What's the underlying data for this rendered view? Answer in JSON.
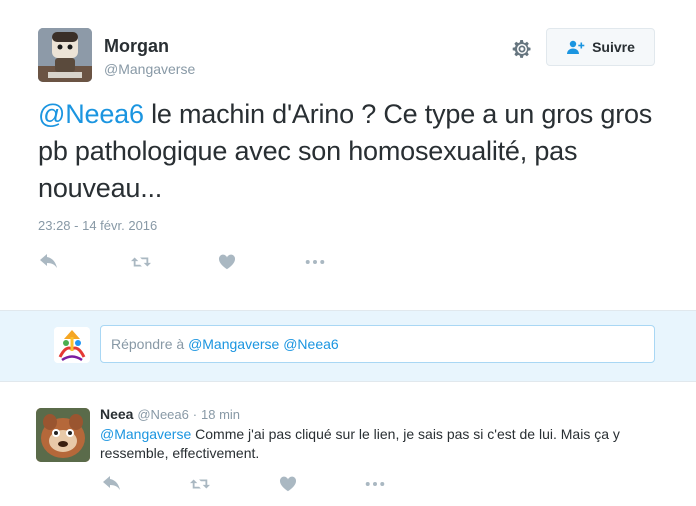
{
  "tweet": {
    "author_name": "Morgan",
    "author_handle": "@Mangaverse",
    "mention": "@Neea6",
    "text": " le machin d'Arino ? Ce type a un gros gros pb pathologique avec son homosexualité, pas nouveau...",
    "timestamp": "23:28 - 14 févr. 2016",
    "follow_label": "Suivre"
  },
  "reply_box": {
    "prefix": "Répondre à ",
    "mention1": "@Mangaverse",
    "mention2": "@Neea6"
  },
  "reply": {
    "author_name": "Neea",
    "author_handle": "@Neea6",
    "separator": "·",
    "time": "18 min",
    "mention": "@Mangaverse",
    "text": " Comme j'ai pas cliqué sur le lien, je sais pas si c'est de lui. Mais ça y ressemble, effectivement."
  },
  "icons": {
    "reply": "reply-icon",
    "retweet": "retweet-icon",
    "like": "heart-icon",
    "more": "more-dots-icon",
    "settings": "gear-icon",
    "follow": "add-user-icon"
  },
  "colors": {
    "link": "#1b95e0",
    "secondary_text": "#8899a6",
    "reply_bg": "#e8f5fd"
  }
}
